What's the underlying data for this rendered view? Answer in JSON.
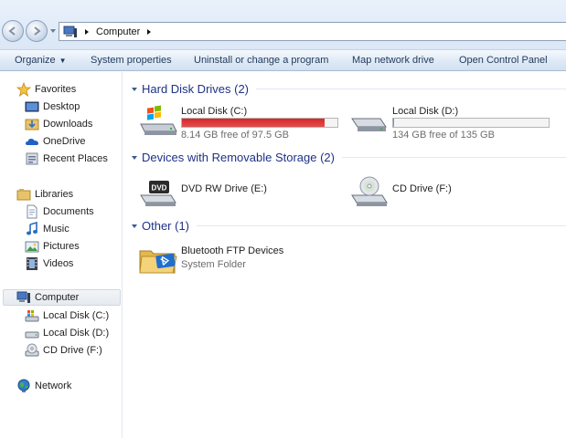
{
  "address_bar": {
    "breadcrumb": [
      "Computer"
    ]
  },
  "command_bar": {
    "organize": "Organize",
    "system_properties": "System properties",
    "uninstall": "Uninstall or change a program",
    "map_drive": "Map network drive",
    "control_panel": "Open Control Panel"
  },
  "nav": {
    "favorites": {
      "label": "Favorites",
      "items": [
        "Desktop",
        "Downloads",
        "OneDrive",
        "Recent Places"
      ]
    },
    "libraries": {
      "label": "Libraries",
      "items": [
        "Documents",
        "Music",
        "Pictures",
        "Videos"
      ]
    },
    "computer": {
      "label": "Computer",
      "items": [
        "Local Disk (C:)",
        "Local Disk (D:)",
        "CD Drive (F:)"
      ]
    },
    "network": {
      "label": "Network"
    }
  },
  "groups": {
    "hard_disks": {
      "title": "Hard Disk Drives (2)",
      "drives": [
        {
          "name": "Local Disk (C:)",
          "free": "8.14 GB free of 97.5 GB",
          "used_fraction": 0.917,
          "bar_color": "#da2626"
        },
        {
          "name": "Local Disk (D:)",
          "free": "134 GB free of 135 GB",
          "used_fraction": 0.007,
          "bar_color": "#26a0da"
        }
      ]
    },
    "removable": {
      "title": "Devices with Removable Storage (2)",
      "devices": [
        "DVD RW Drive (E:)",
        "CD Drive (F:)"
      ]
    },
    "other": {
      "title": "Other (1)",
      "items": [
        {
          "name": "Bluetooth FTP Devices",
          "sub": "System Folder"
        }
      ]
    }
  },
  "icons": {
    "dvd_badge": "DVD"
  },
  "colors": {
    "accent": "#1e3287",
    "critical_bar": "#da2626"
  }
}
